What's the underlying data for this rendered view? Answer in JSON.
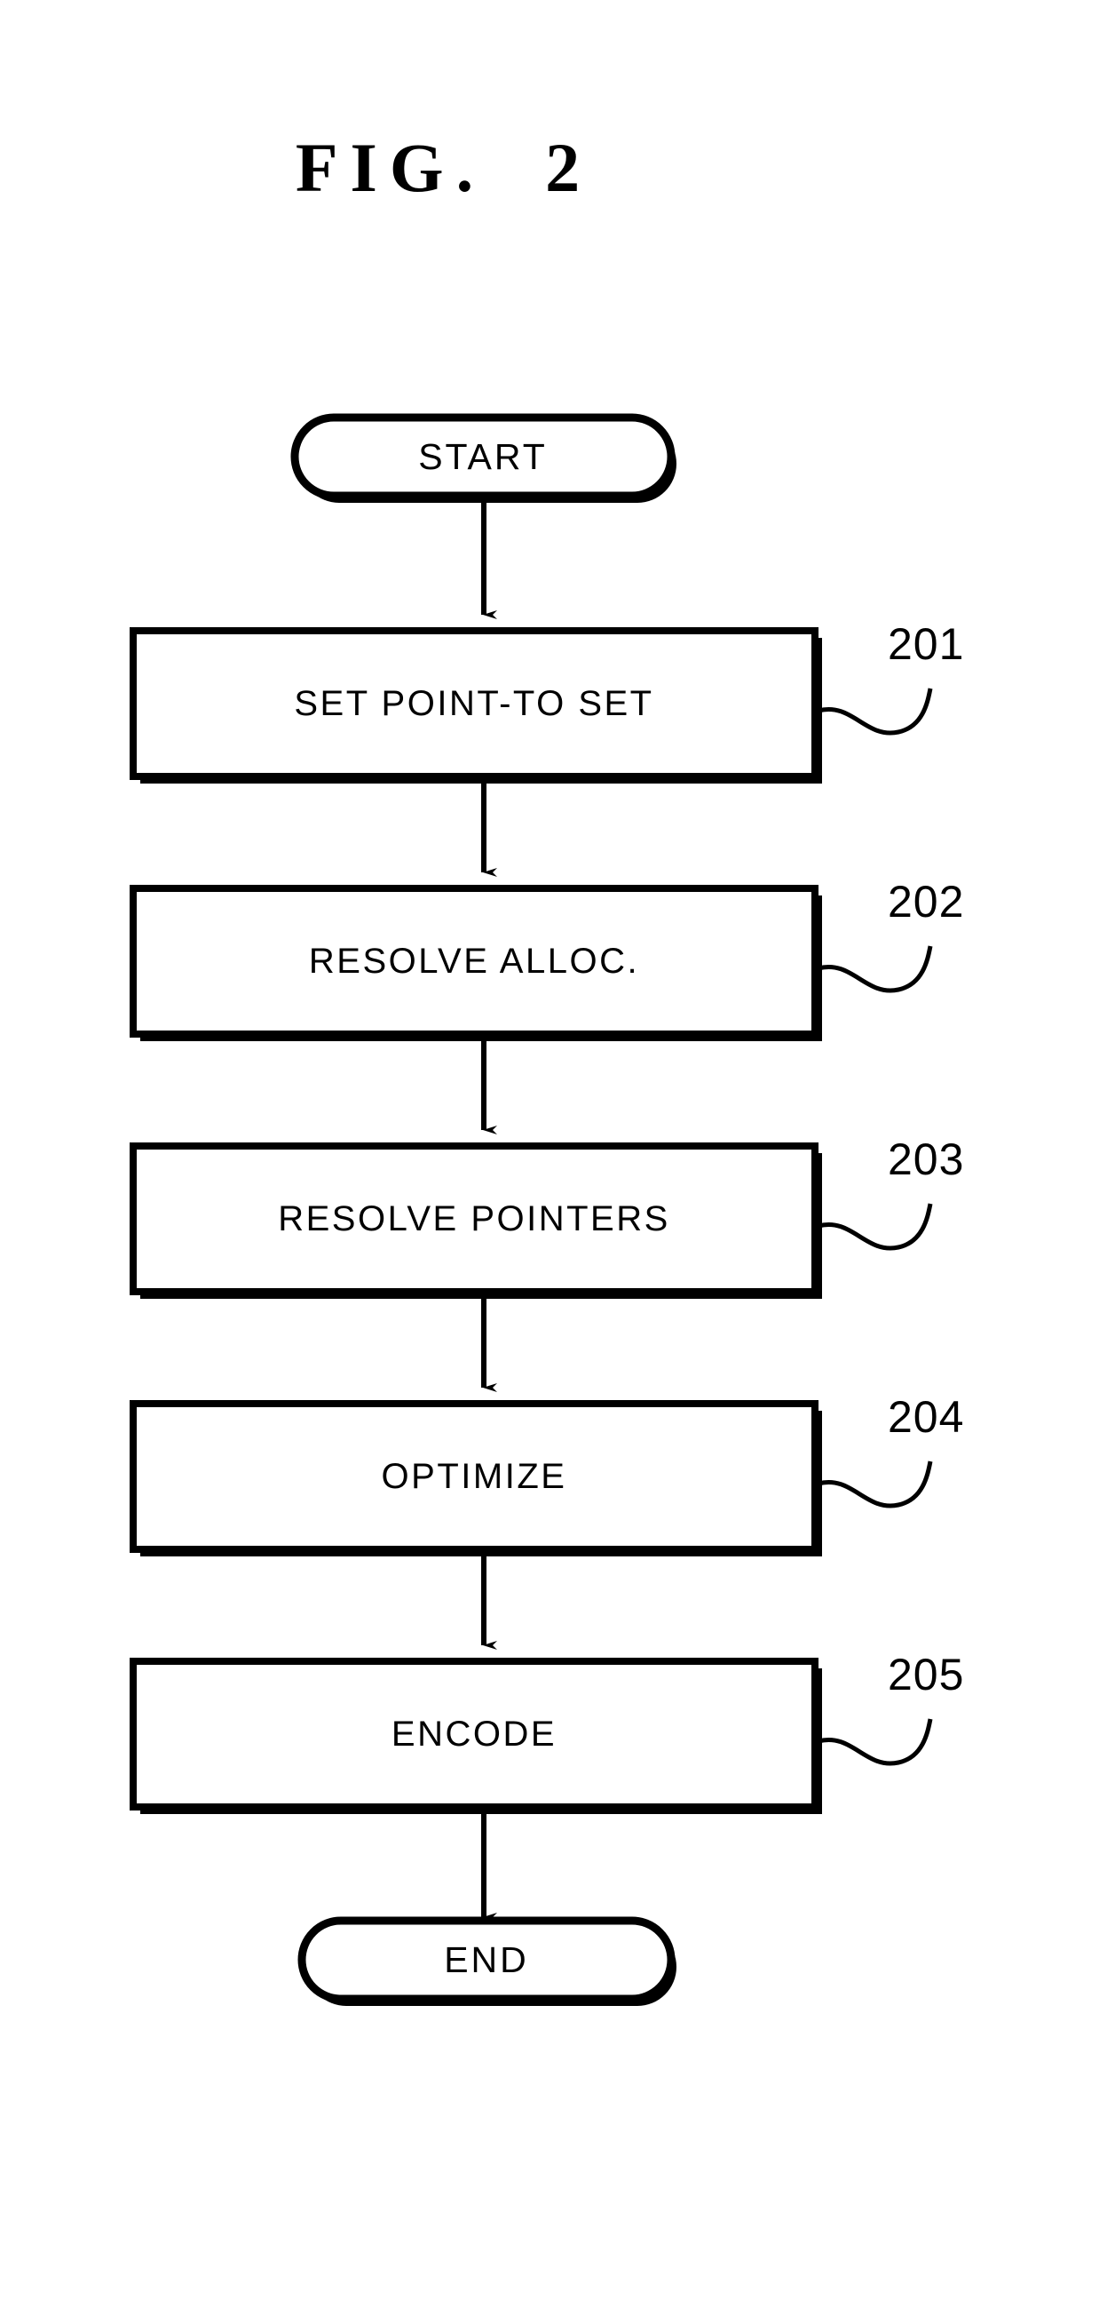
{
  "figure": {
    "title": "FIG.  2",
    "type": "flowchart",
    "background_color": "#ffffff",
    "ink_color": "#000000"
  },
  "flow": {
    "start_terminal": {
      "label": "START",
      "shape": "stadium"
    },
    "end_terminal": {
      "label": "END",
      "shape": "stadium"
    },
    "steps": [
      {
        "label": "SET POINT-TO SET",
        "ref": "201"
      },
      {
        "label": "RESOLVE ALLOC.",
        "ref": "202"
      },
      {
        "label": "RESOLVE POINTERS",
        "ref": "203"
      },
      {
        "label": "OPTIMIZE",
        "ref": "204"
      },
      {
        "label": "ENCODE",
        "ref": "205"
      }
    ],
    "connector_count": 6,
    "connector_style": "solid-line-with-filled-arrowhead"
  }
}
